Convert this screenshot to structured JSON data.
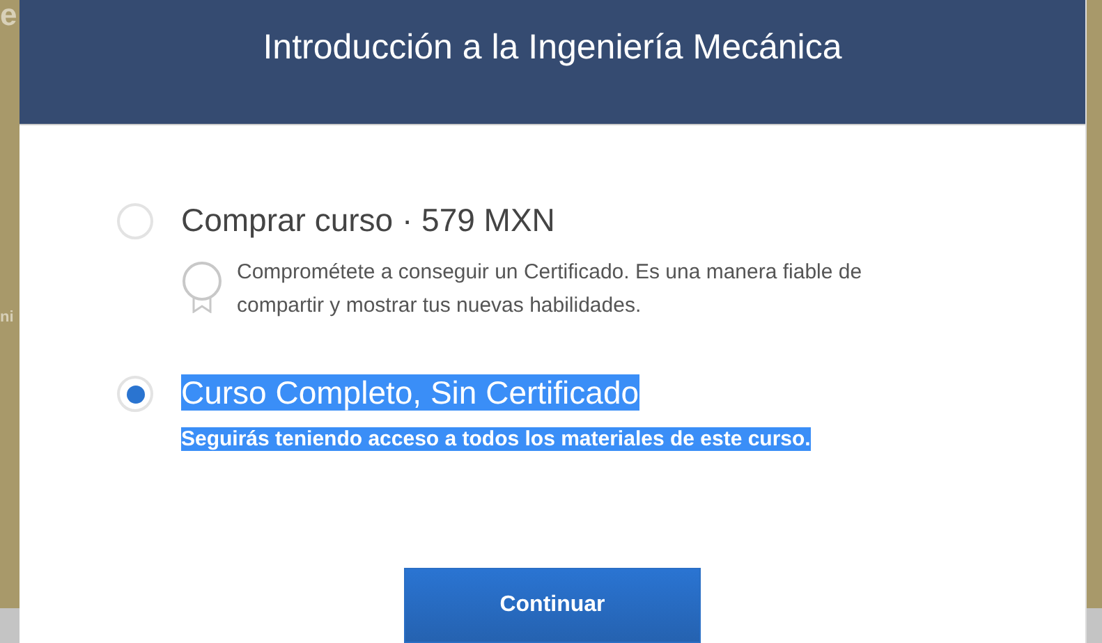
{
  "background": {
    "fragments": [
      "e",
      "ni"
    ]
  },
  "dialog": {
    "title": "Introducción a la Ingeniería Mecánica",
    "options": [
      {
        "title": "Comprar curso · 579 MXN",
        "description": "Comprométete a conseguir un Certificado. Es una manera fiable de compartir y mostrar tus nuevas habilidades.",
        "kind": "certificate",
        "selected": false,
        "highlighted": false
      },
      {
        "title": "Curso Completo, Sin Certificado",
        "description": "Seguirás teniendo acceso a todos los materiales de este curso.",
        "kind": "plain",
        "selected": true,
        "highlighted": true
      }
    ],
    "button": "Continuar"
  }
}
